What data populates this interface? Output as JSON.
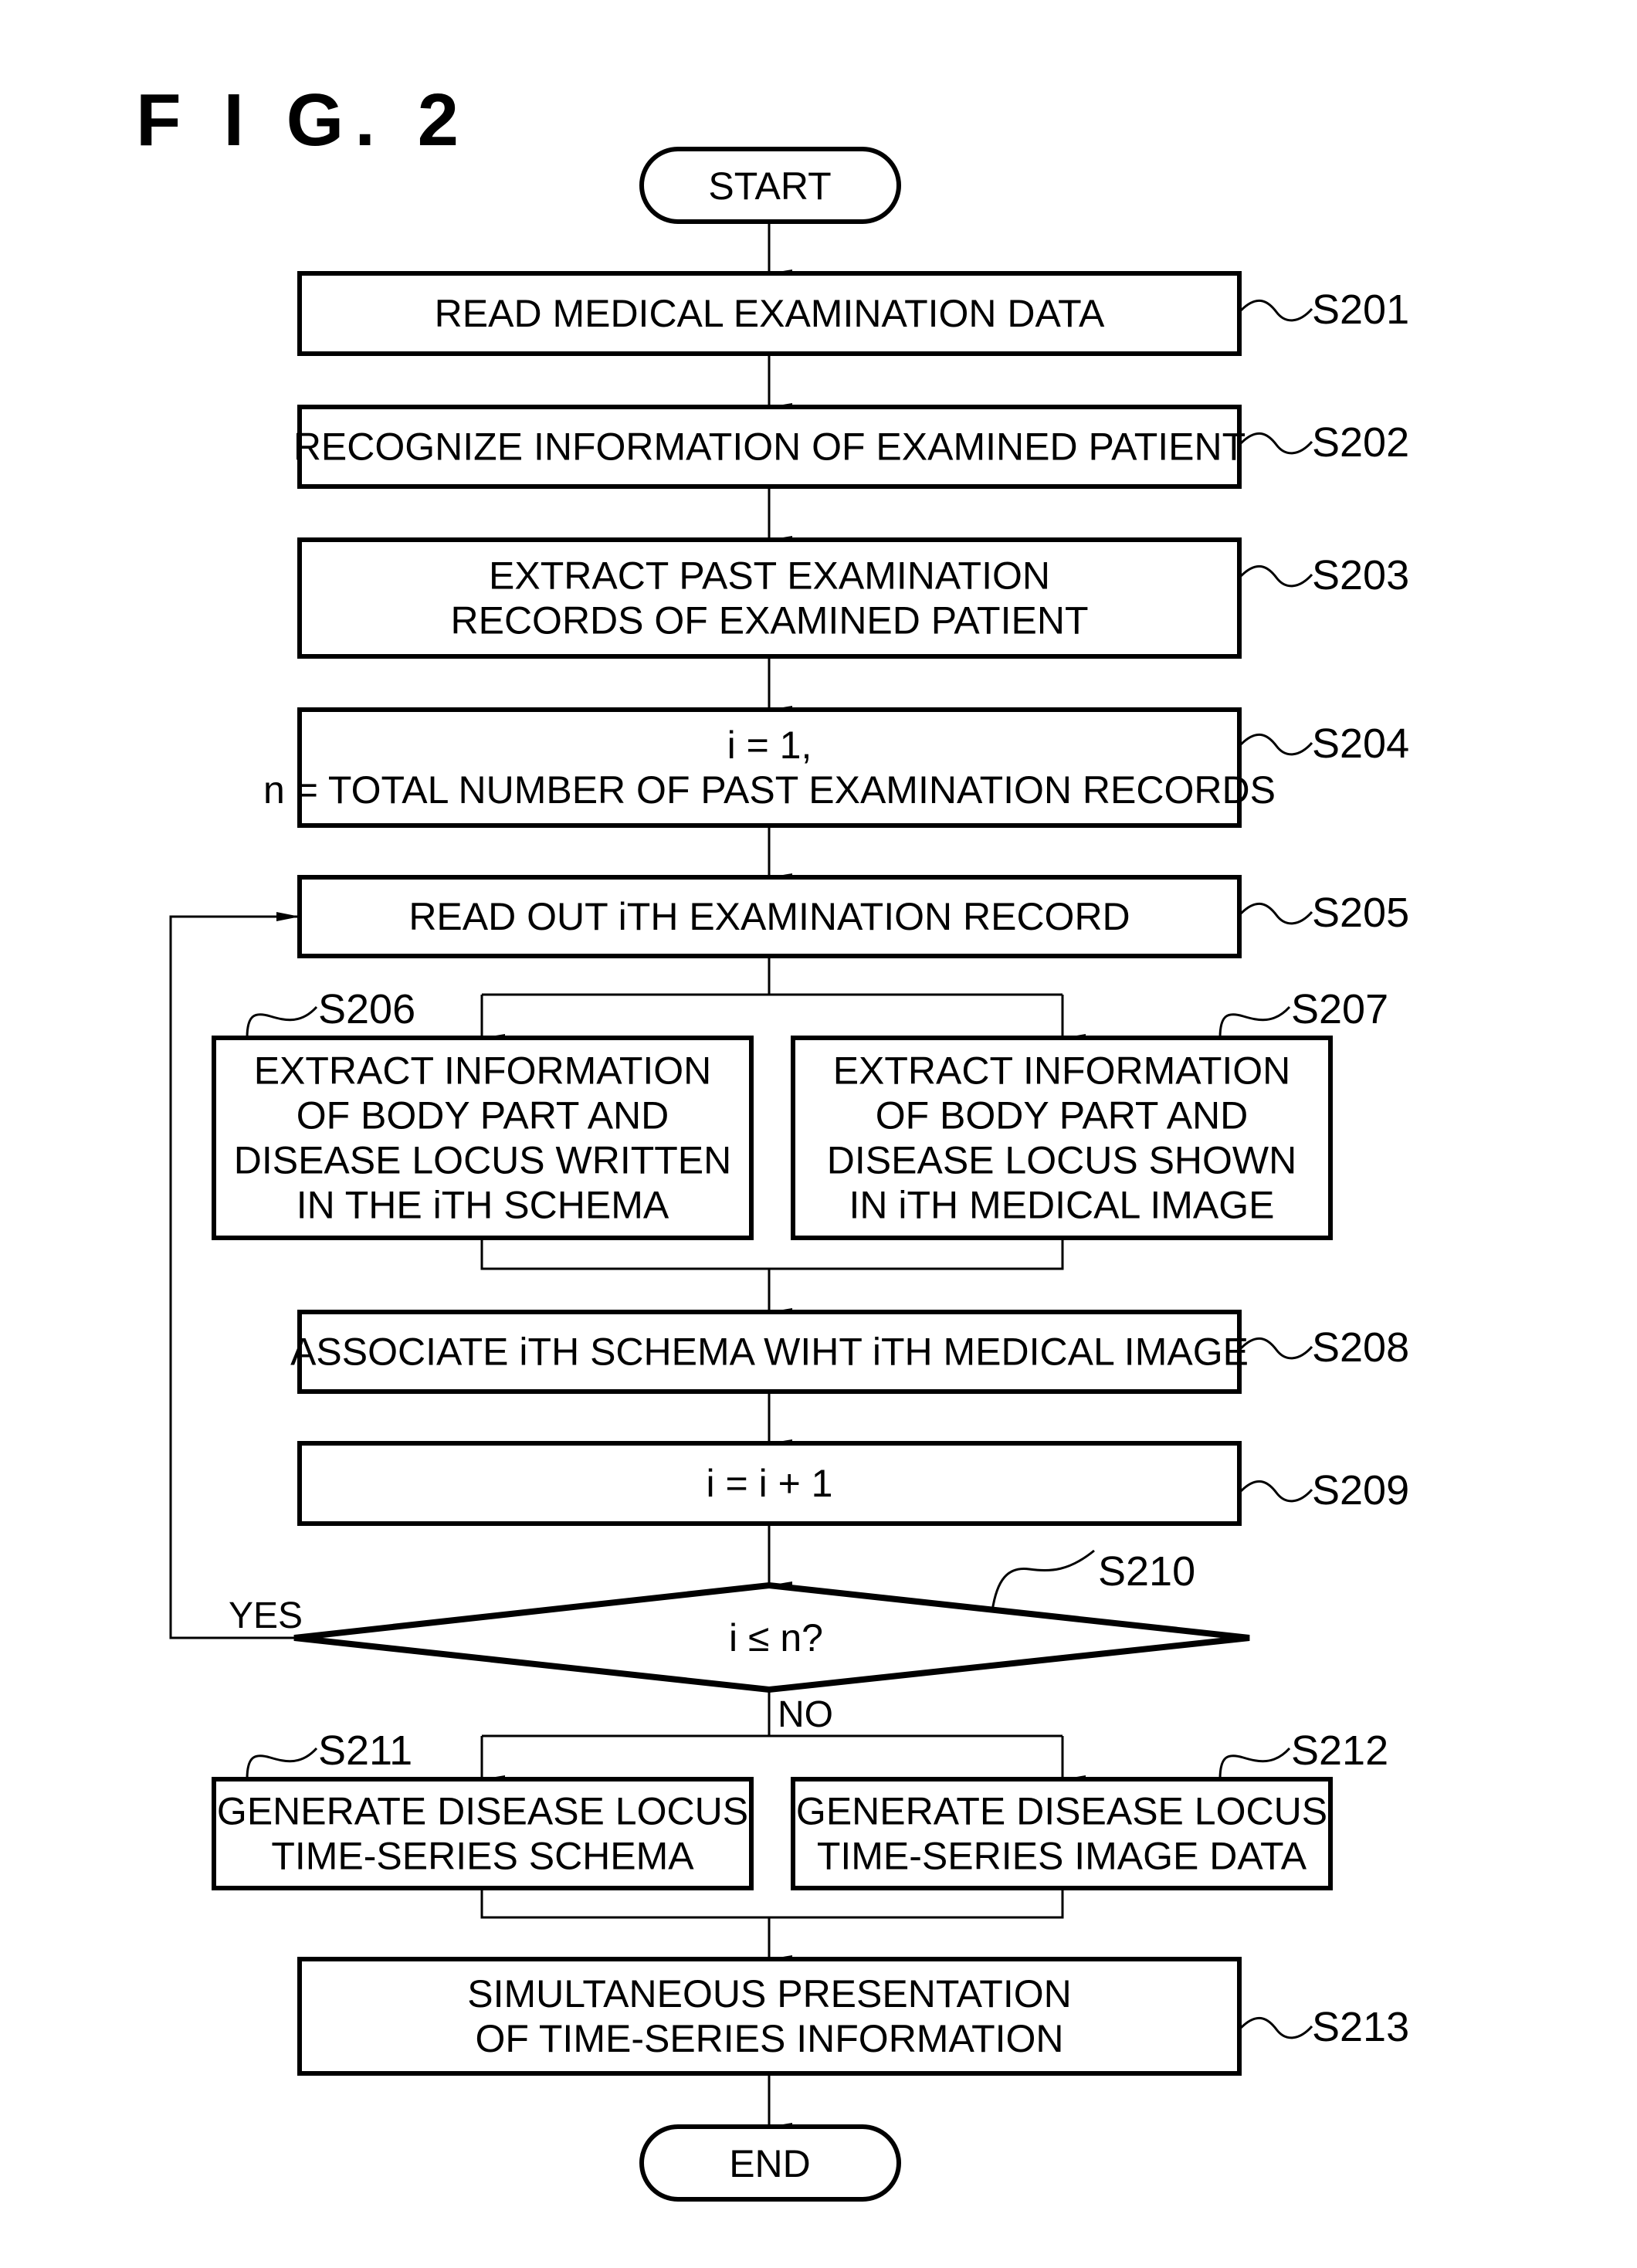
{
  "figure": {
    "title": "F I G.  2"
  },
  "terminals": {
    "start": "START",
    "end": "END"
  },
  "steps": {
    "S201": {
      "id": "S201",
      "lines": [
        "READ MEDICAL EXAMINATION DATA"
      ]
    },
    "S202": {
      "id": "S202",
      "lines": [
        "RECOGNIZE INFORMATION OF EXAMINED PATIENT"
      ]
    },
    "S203": {
      "id": "S203",
      "lines": [
        "EXTRACT PAST EXAMINATION",
        "RECORDS OF EXAMINED PATIENT"
      ]
    },
    "S204": {
      "id": "S204",
      "lines": [
        "i = 1,",
        "n = TOTAL NUMBER OF PAST EXAMINATION RECORDS"
      ]
    },
    "S205": {
      "id": "S205",
      "lines": [
        "READ OUT iTH EXAMINATION RECORD"
      ]
    },
    "S206": {
      "id": "S206",
      "lines": [
        "EXTRACT INFORMATION",
        "OF BODY PART AND",
        "DISEASE LOCUS WRITTEN",
        "IN THE iTH SCHEMA"
      ]
    },
    "S207": {
      "id": "S207",
      "lines": [
        "EXTRACT INFORMATION",
        "OF BODY PART AND",
        "DISEASE  LOCUS SHOWN",
        "IN iTH MEDICAL IMAGE"
      ]
    },
    "S208": {
      "id": "S208",
      "lines": [
        "ASSOCIATE iTH SCHEMA WIHT iTH MEDICAL IMAGE"
      ]
    },
    "S209": {
      "id": "S209",
      "lines": [
        "i = i + 1"
      ]
    },
    "S210": {
      "id": "S210",
      "lines": [
        "i ≤ n?"
      ]
    },
    "S211": {
      "id": "S211",
      "lines": [
        "GENERATE DISEASE LOCUS",
        "TIME-SERIES SCHEMA"
      ]
    },
    "S212": {
      "id": "S212",
      "lines": [
        "GENERATE DISEASE LOCUS",
        "TIME-SERIES IMAGE DATA"
      ]
    },
    "S213": {
      "id": "S213",
      "lines": [
        "SIMULTANEOUS PRESENTATION",
        "OF TIME-SERIES INFORMATION"
      ]
    }
  },
  "branches": {
    "yes": "YES",
    "no": "NO"
  },
  "colors": {
    "stroke": "#000000",
    "background": "#ffffff"
  }
}
